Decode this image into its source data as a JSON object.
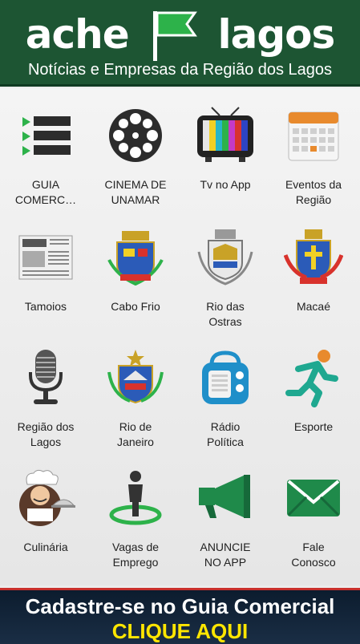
{
  "header": {
    "brand_left": "ache",
    "brand_right": "lagos",
    "tagline": "Notícias e Empresas da Região dos Lagos"
  },
  "tiles": [
    {
      "label": "GUIA\nCOMERC…",
      "icon": "list-icon"
    },
    {
      "label": "CINEMA DE\nUNAMAR",
      "icon": "film-reel-icon"
    },
    {
      "label": "Tv no App",
      "icon": "tv-icon"
    },
    {
      "label": "Eventos da\nRegião",
      "icon": "calendar-icon"
    },
    {
      "label": "Tamoios",
      "icon": "newspaper-icon"
    },
    {
      "label": "Cabo Frio",
      "icon": "coat-of-arms-icon"
    },
    {
      "label": "Rio das\nOstras",
      "icon": "coat-of-arms-icon"
    },
    {
      "label": "Macaé",
      "icon": "coat-of-arms-icon"
    },
    {
      "label": "Região dos\nLagos",
      "icon": "microphone-icon"
    },
    {
      "label": "Rio de\nJaneiro",
      "icon": "coat-of-arms-icon"
    },
    {
      "label": "Rádio\nPolítica",
      "icon": "radio-icon"
    },
    {
      "label": "Esporte",
      "icon": "runner-icon"
    },
    {
      "label": "Culinária",
      "icon": "chef-icon"
    },
    {
      "label": "Vagas de\nEmprego",
      "icon": "person-icon"
    },
    {
      "label": "ANUNCIE\nNO APP",
      "icon": "megaphone-icon"
    },
    {
      "label": "Fale\nConosco",
      "icon": "envelope-icon"
    }
  ],
  "banner": {
    "line1": "Cadastre-se no Guia Comercial",
    "line2": "CLIQUE AQUI"
  },
  "colors": {
    "header_bg": "#1d5533",
    "banner_bg": "#0c1c2e",
    "cta_yellow": "#ffe600",
    "accent_red": "#c9302c"
  }
}
